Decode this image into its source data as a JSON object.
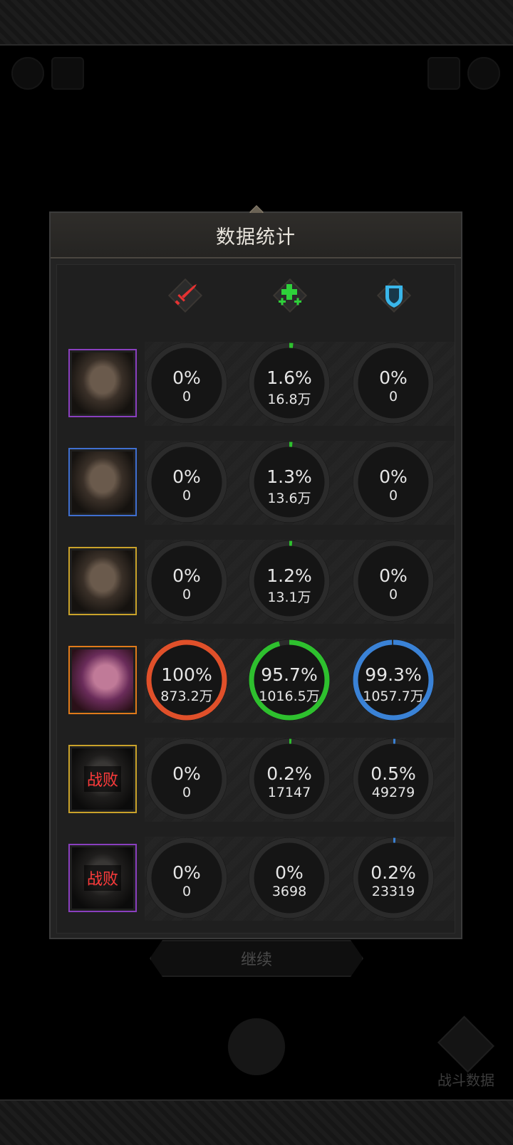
{
  "panel": {
    "title": "数据统计"
  },
  "columns": [
    {
      "icon": "damage-sword-icon",
      "color": "#e53232"
    },
    {
      "icon": "healing-plus-icon",
      "color": "#2ed13a"
    },
    {
      "icon": "shield-icon",
      "color": "#39b6ea"
    }
  ],
  "heroes": [
    {
      "frame_color": "#8a3fbf",
      "defeated": false,
      "stats": [
        {
          "pct": "0%",
          "val": "0",
          "fraction": 0
        },
        {
          "pct": "1.6%",
          "val": "16.8万",
          "fraction": 0.016
        },
        {
          "pct": "0%",
          "val": "0",
          "fraction": 0
        }
      ]
    },
    {
      "frame_color": "#3f6fd0",
      "defeated": false,
      "stats": [
        {
          "pct": "0%",
          "val": "0",
          "fraction": 0
        },
        {
          "pct": "1.3%",
          "val": "13.6万",
          "fraction": 0.013
        },
        {
          "pct": "0%",
          "val": "0",
          "fraction": 0
        }
      ]
    },
    {
      "frame_color": "#c9a22a",
      "defeated": false,
      "stats": [
        {
          "pct": "0%",
          "val": "0",
          "fraction": 0
        },
        {
          "pct": "1.2%",
          "val": "13.1万",
          "fraction": 0.012
        },
        {
          "pct": "0%",
          "val": "0",
          "fraction": 0
        }
      ]
    },
    {
      "frame_color": "#e07a1a",
      "defeated": false,
      "stats": [
        {
          "pct": "100%",
          "val": "873.2万",
          "fraction": 1.0
        },
        {
          "pct": "95.7%",
          "val": "1016.5万",
          "fraction": 0.957
        },
        {
          "pct": "99.3%",
          "val": "1057.7万",
          "fraction": 0.993
        }
      ]
    },
    {
      "frame_color": "#c9a22a",
      "defeated": true,
      "defeat_label": "战败",
      "stats": [
        {
          "pct": "0%",
          "val": "0",
          "fraction": 0
        },
        {
          "pct": "0.2%",
          "val": "17147",
          "fraction": 0.002
        },
        {
          "pct": "0.5%",
          "val": "49279",
          "fraction": 0.005
        }
      ]
    },
    {
      "frame_color": "#8a3fbf",
      "defeated": true,
      "defeat_label": "战败",
      "stats": [
        {
          "pct": "0%",
          "val": "0",
          "fraction": 0
        },
        {
          "pct": "0%",
          "val": "3698",
          "fraction": 0
        },
        {
          "pct": "0.2%",
          "val": "23319",
          "fraction": 0.002
        }
      ]
    }
  ],
  "ring_colors": [
    "#e0502a",
    "#2ec02e",
    "#3a82d6"
  ],
  "buttons": {
    "continue": "继续",
    "battle_data": "战斗数据"
  }
}
